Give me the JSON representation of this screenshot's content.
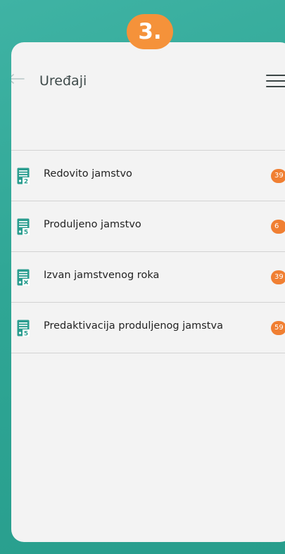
{
  "step_badge": "3.",
  "header": {
    "title": "Uređaji",
    "back_icon": "arrow-left-icon",
    "menu_icon": "hamburger-menu-icon"
  },
  "colors": {
    "teal": "#2a9d8f",
    "orange": "#f5923a",
    "badge": "#f07f32"
  },
  "items": [
    {
      "label": "Redovito jamstvo",
      "count": "39",
      "icon": "document-2-icon",
      "icon_mark": "2"
    },
    {
      "label": "Produljeno jamstvo",
      "count": "6",
      "icon": "document-5-icon",
      "icon_mark": "5"
    },
    {
      "label": "Izvan jamstvenog roka",
      "count": "39",
      "icon": "document-x-icon",
      "icon_mark": "x"
    },
    {
      "label": "Predaktivacija produljenog jamstva",
      "count": "59",
      "icon": "document-5-icon",
      "icon_mark": "5"
    }
  ]
}
